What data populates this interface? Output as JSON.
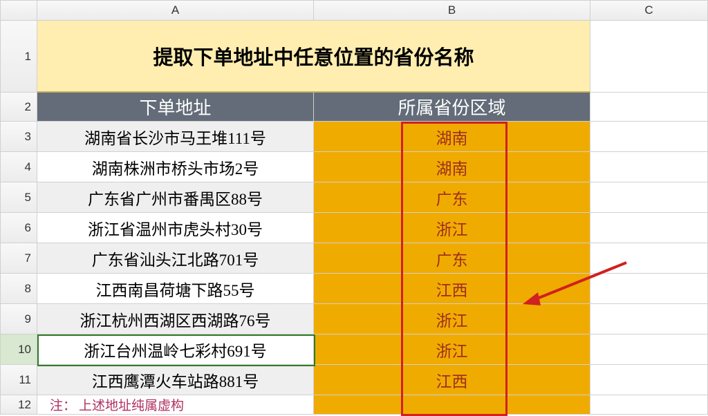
{
  "cols": [
    "A",
    "B"
  ],
  "rows": [
    "1",
    "2",
    "3",
    "4",
    "5",
    "6",
    "7",
    "8",
    "9",
    "10",
    "11",
    "12"
  ],
  "title": "提取下单地址中任意位置的省份名称",
  "headers": {
    "addr": "下单地址",
    "prov": "所属省份区域"
  },
  "data": [
    {
      "addr": "湖南省长沙市马王堆111号",
      "prov": "湖南"
    },
    {
      "addr": "湖南株洲市桥头市场2号",
      "prov": "湖南"
    },
    {
      "addr": "广东省广州市番禺区88号",
      "prov": "广东"
    },
    {
      "addr": "浙江省温州市虎头村30号",
      "prov": "浙江"
    },
    {
      "addr": "广东省汕头江北路701号",
      "prov": "广东"
    },
    {
      "addr": "江西南昌荷塘下路55号",
      "prov": "江西"
    },
    {
      "addr": "浙江杭州西湖区西湖路76号",
      "prov": "浙江"
    },
    {
      "addr": "浙江台州温岭七彩村691号",
      "prov": "浙江"
    },
    {
      "addr": "江西鹰潭火车站路881号",
      "prov": "江西"
    }
  ],
  "note_prefix": "注：",
  "note_text": "上述地址纯属虚构",
  "selected_row": "10",
  "colors": {
    "highlight_box": "#d02020",
    "gold_fill": "#f0ab00"
  }
}
